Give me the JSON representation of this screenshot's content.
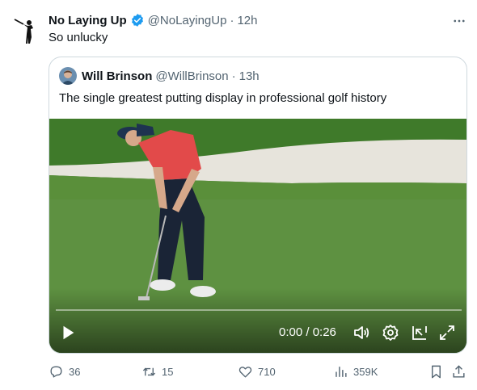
{
  "tweet": {
    "author_name": "No Laying Up",
    "handle": "@NoLayingUp",
    "dot": "·",
    "time": "12h",
    "text": "So unlucky",
    "avatar_icon": "golfer-silhouette-icon",
    "verified_color": "#1d9bf0"
  },
  "quote": {
    "author_name": "Will Brinson",
    "handle": "@WillBrinson",
    "dot": "·",
    "time": "13h",
    "text": "The single greatest putting display in professional golf history"
  },
  "video": {
    "time_display": "0:00 / 0:26",
    "progress_fraction": 0.0,
    "controls": [
      "play-icon",
      "volume-icon",
      "settings-icon",
      "pop-out-icon",
      "fullscreen-icon"
    ]
  },
  "actions": {
    "replies": "36",
    "retweets": "15",
    "likes": "710",
    "views": "359K"
  },
  "colors": {
    "text": "#0f1419",
    "secondary": "#536471",
    "border": "#cfd9de"
  }
}
